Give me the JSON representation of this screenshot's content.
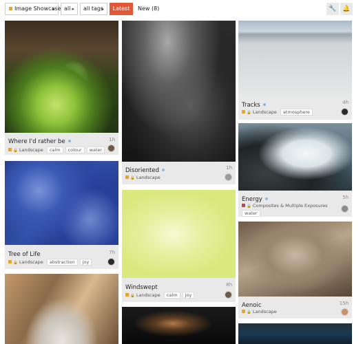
{
  "nav": {
    "category": "Image Showcase",
    "filter": "all",
    "tags": "all tags",
    "latest": "Latest",
    "new": "New (8)",
    "caret": "▸",
    "wrench_icon": "🔧",
    "bell_icon": "🔔"
  },
  "colors": {
    "accent": "#e45735",
    "category_landscape": "#e1a634",
    "category_composites": "#b3495b",
    "card_bg": "#e9e9e9"
  },
  "topics": [
    {
      "title": "Where I'd rather be",
      "age": "1h",
      "category": "Landscape",
      "tags": [
        "calm",
        "colour",
        "water"
      ]
    },
    {
      "title": "Tree of Life",
      "age": "7h",
      "category": "Landscape",
      "tags": [
        "abstraction",
        "joy"
      ]
    },
    {
      "title": "",
      "age": "",
      "category": "",
      "tags": []
    },
    {
      "title": "Disoriented",
      "age": "1h",
      "category": "Landscape",
      "tags": []
    },
    {
      "title": "Windswept",
      "age": "8h",
      "category": "Landscape",
      "tags": [
        "calm",
        "joy"
      ]
    },
    {
      "title": "",
      "age": "",
      "category": "",
      "tags": []
    },
    {
      "title": "Tracks",
      "age": "4h",
      "category": "Landscape",
      "tags": [
        "atmosphere"
      ]
    },
    {
      "title": "Energy",
      "age": "5h",
      "category": "Composites & Multiple Exposures",
      "tags": [
        "water"
      ]
    },
    {
      "title": "Aenoic",
      "age": "15h",
      "category": "Landscape",
      "tags": []
    },
    {
      "title": "",
      "age": "",
      "category": "",
      "tags": []
    }
  ]
}
